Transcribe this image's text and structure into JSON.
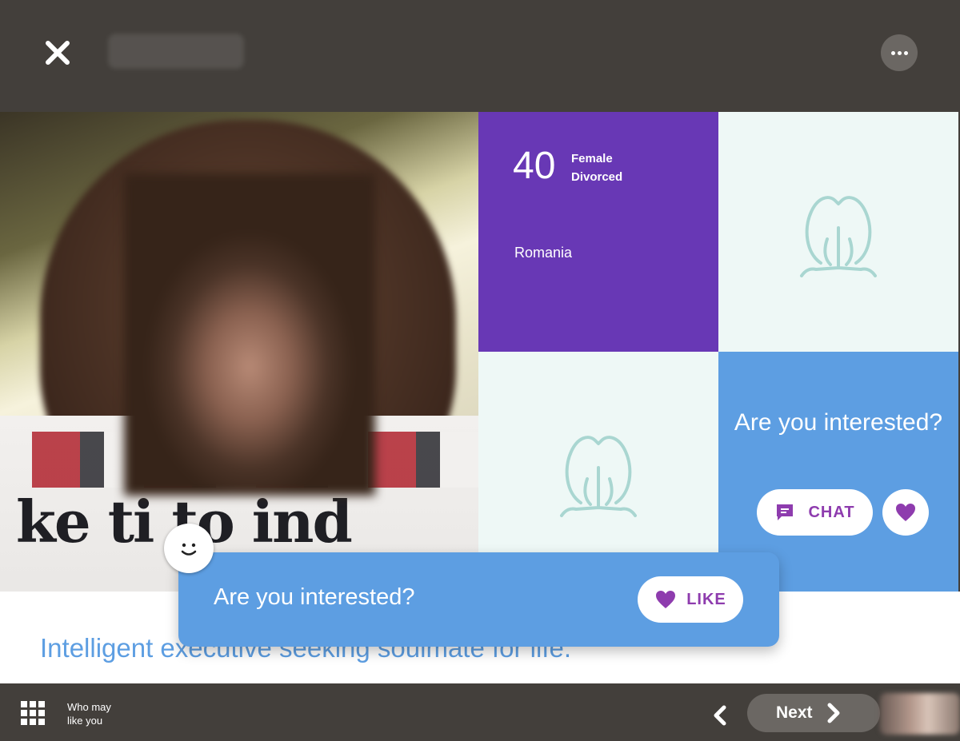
{
  "header": {
    "close_icon": "close-icon",
    "profile_name": "",
    "more_icon": "more-dots-icon"
  },
  "profile": {
    "age": "40",
    "gender": "Female",
    "marital_status": "Divorced",
    "country": "Romania",
    "bio": "Intelligent executive seeking soulmate for life.",
    "photo_text": "ke ti    to ind"
  },
  "cta_tile": {
    "title": "Are you interested?",
    "chat_label": "CHAT",
    "chat_icon": "chat-bubble-icon",
    "heart_icon": "heart-icon"
  },
  "popup": {
    "text": "Are you interested?",
    "like_label": "LIKE",
    "like_icon": "heart-icon"
  },
  "footer": {
    "who_may_like_line1": "Who may",
    "who_may_like_line2": "like you",
    "next_label": "Next"
  },
  "colors": {
    "dark_bar": "#433f3b",
    "purple_tile": "#6838b5",
    "blue": "#5d9ee2",
    "light_tile": "#eef8f6",
    "placeholder_icon": "#a9d6d1",
    "accent_purple": "#8e3cae"
  }
}
